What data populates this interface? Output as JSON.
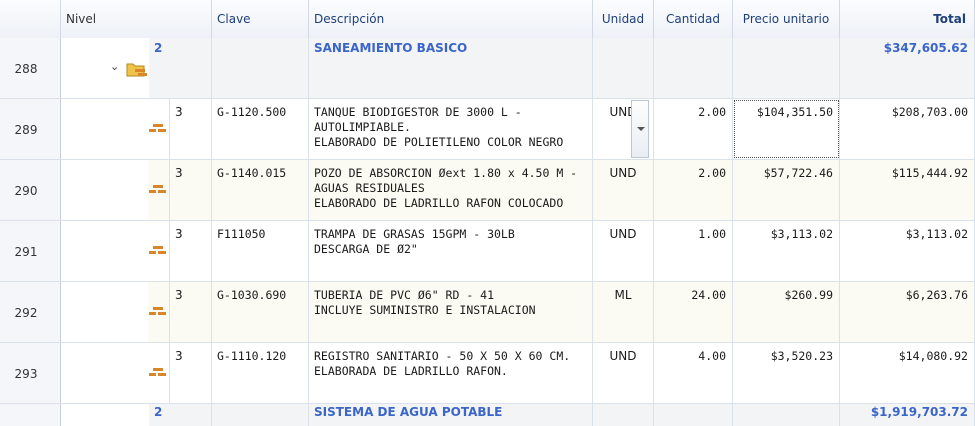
{
  "columns": {
    "nivel": "Nivel",
    "clave": "Clave",
    "descripcion": "Descripción",
    "unidad": "Unidad",
    "cantidad": "Cantidad",
    "precio": "Precio unitario",
    "total": "Total"
  },
  "group1": {
    "row_no": "288",
    "level": "2",
    "description": "SANEAMIENTO BASICO",
    "total": "$347,605.62"
  },
  "items": [
    {
      "row_no": "289",
      "level": "3",
      "clave": "G-1120.500",
      "description": "TANQUE BIODIGESTOR DE 3000 L -\nAUTOLIMPIABLE.\nELABORADO DE POLIETILENO COLOR NEGRO",
      "unidad": "UND",
      "cantidad": "2.00",
      "precio": "$104,351.50",
      "total": "$208,703.00"
    },
    {
      "row_no": "290",
      "level": "3",
      "clave": "G-1140.015",
      "description": "POZO DE ABSORCION Øext 1.80 x 4.50 M -\nAGUAS RESIDUALES\nELABORADO DE LADRILLO RAFON COLOCADO",
      "unidad": "UND",
      "cantidad": "2.00",
      "precio": "$57,722.46",
      "total": "$115,444.92"
    },
    {
      "row_no": "291",
      "level": "3",
      "clave": "F111050",
      "description": "TRAMPA DE GRASAS 15GPM - 30LB\nDESCARGA DE Ø2\"",
      "unidad": "UND",
      "cantidad": "1.00",
      "precio": "$3,113.02",
      "total": "$3,113.02"
    },
    {
      "row_no": "292",
      "level": "3",
      "clave": "G-1030.690",
      "description": "TUBERIA DE PVC Ø6\" RD - 41\nINCLUYE SUMINISTRO E INSTALACION",
      "unidad": "ML",
      "cantidad": "24.00",
      "precio": "$260.99",
      "total": "$6,263.76"
    },
    {
      "row_no": "293",
      "level": "3",
      "clave": "G-1110.120",
      "description": "REGISTRO SANITARIO - 50 X 50 X 60 CM.\nELABORADA DE LADRILLO RAFON.",
      "unidad": "UND",
      "cantidad": "4.00",
      "precio": "$3,520.23",
      "total": "$14,080.92"
    }
  ],
  "group2": {
    "level": "2",
    "description": "SISTEMA DE AGUA POTABLE",
    "total": "$1,919,703.72"
  },
  "icons": {
    "expand": "chevron-down-icon",
    "group": "folder-group-icon",
    "item": "brick-item-icon"
  },
  "colors": {
    "group_text": "#3a65c9",
    "header_text": "#1f3f7a",
    "item_icon": "#d9852a"
  }
}
